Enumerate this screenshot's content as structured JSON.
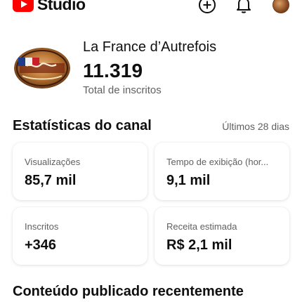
{
  "app": {
    "logo_text": "Studio"
  },
  "channel": {
    "name": "La France d’Autrefois",
    "subscriber_count": "11.319",
    "subscriber_label": "Total de inscritos"
  },
  "stats": {
    "title": "Estatísticas do canal",
    "period": "Últimos 28 dias",
    "cards": [
      {
        "label": "Visualizações",
        "value": "85,7 mil"
      },
      {
        "label": "Tempo de exibição (hor...",
        "value": "9,1 mil"
      },
      {
        "label": "Inscritos",
        "value": "+346"
      },
      {
        "label": "Receita estimada",
        "value": "R$ 2,1 mil"
      }
    ]
  },
  "recent": {
    "title": "Conteúdo publicado recentemente"
  },
  "colors": {
    "brand_red": "#ff0000",
    "text_primary": "#0f0f0f",
    "text_secondary": "#606060"
  }
}
